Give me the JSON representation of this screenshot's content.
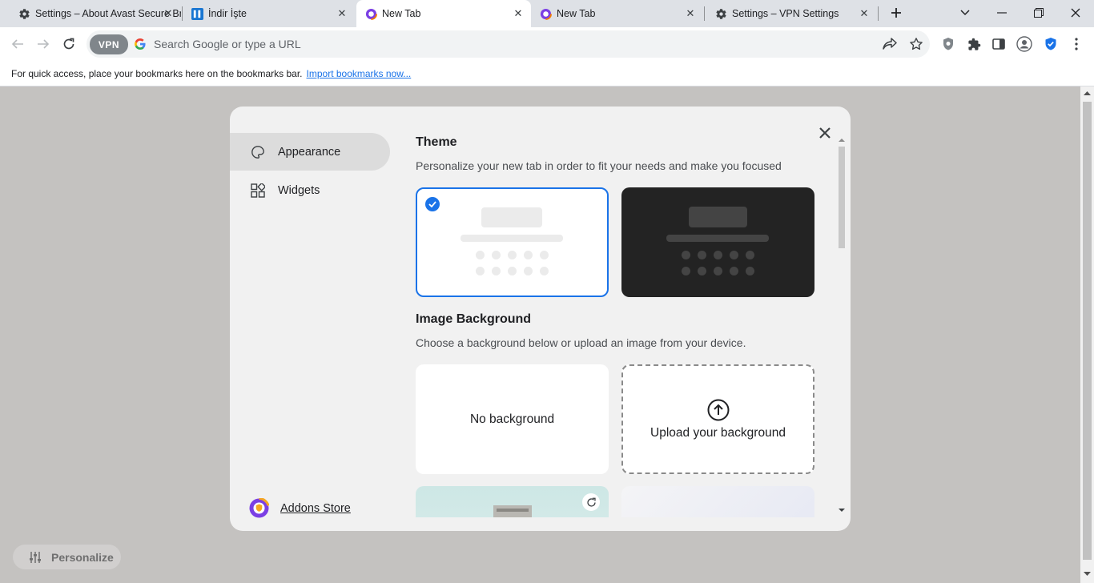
{
  "tabs": [
    {
      "title": "Settings – About Avast Secure Browser",
      "icon": "gear-icon"
    },
    {
      "title": "İndir İşte",
      "icon": "indir-favicon"
    },
    {
      "title": "New Tab",
      "icon": "avast-browser-icon",
      "active": true
    },
    {
      "title": "New Tab",
      "icon": "avast-browser-icon"
    },
    {
      "title": "Settings – VPN Settings",
      "icon": "gear-icon"
    }
  ],
  "toolbar": {
    "vpn_label": "VPN",
    "omnibox_placeholder": "Search Google or type a URL"
  },
  "bookmarks_bar": {
    "text": "For quick access, place your bookmarks here on the bookmarks bar.",
    "link": "Import bookmarks now..."
  },
  "panel": {
    "nav": {
      "appearance": "Appearance",
      "widgets": "Widgets",
      "addons": "Addons Store"
    },
    "theme": {
      "heading": "Theme",
      "description": "Personalize your new tab in order to fit your needs and make you focused",
      "selected": "light"
    },
    "image_background": {
      "heading": "Image Background",
      "description": "Choose a background below or upload an image from your device.",
      "no_background": "No background",
      "upload": "Upload your background"
    }
  },
  "personalize_button": "Personalize",
  "colors": {
    "accent": "#1a73e8",
    "page_bg": "#c4c2c0",
    "panel_bg": "#f1f1f1",
    "dark_theme": "#232323"
  }
}
